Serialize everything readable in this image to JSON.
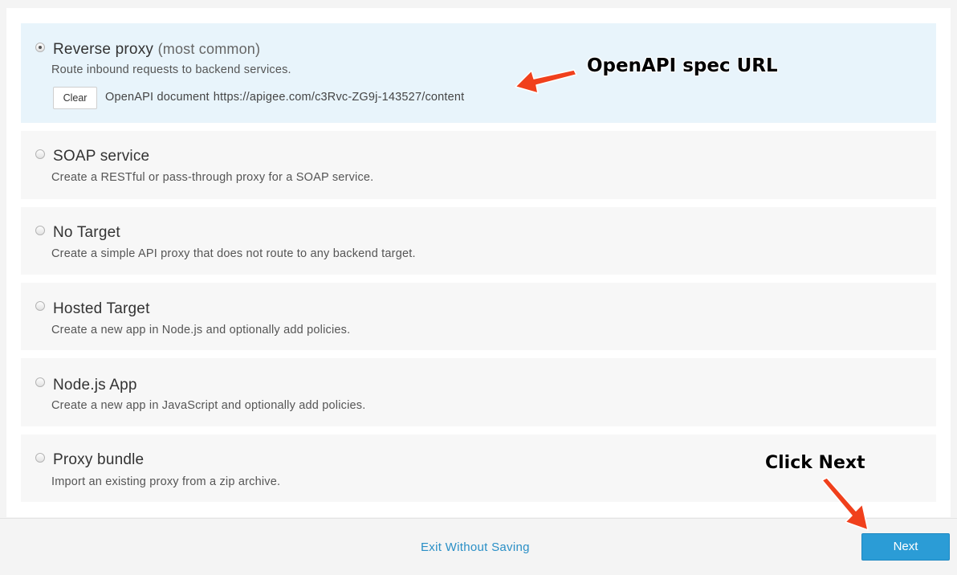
{
  "options": [
    {
      "title": "Reverse proxy",
      "title_suffix": "(most common)",
      "description": "Route inbound requests to backend services.",
      "selected": true,
      "clear_label": "Clear",
      "document_label": "OpenAPI document",
      "document_url": "https://apigee.com/c3Rvc-ZG9j-143527/content"
    },
    {
      "title": "SOAP service",
      "description": "Create a RESTful or pass-through proxy for a SOAP service.",
      "selected": false
    },
    {
      "title": "No Target",
      "description": "Create a simple API proxy that does not route to any backend target.",
      "selected": false
    },
    {
      "title": "Hosted Target",
      "description": "Create a new app in Node.js and optionally add policies.",
      "selected": false
    },
    {
      "title": "Node.js App",
      "description": "Create a new app in JavaScript and optionally add policies.",
      "selected": false
    },
    {
      "title": "Proxy bundle",
      "description": "Import an existing proxy from a zip archive.",
      "selected": false
    }
  ],
  "footer": {
    "exit_label": "Exit Without Saving",
    "next_label": "Next"
  },
  "annotations": {
    "spec_url": "OpenAPI spec URL",
    "click_next": "Click Next"
  },
  "colors": {
    "accent": "#2b9cd6",
    "selected_bg": "#e8f4fb",
    "annotation_arrow": "#f0401c"
  }
}
